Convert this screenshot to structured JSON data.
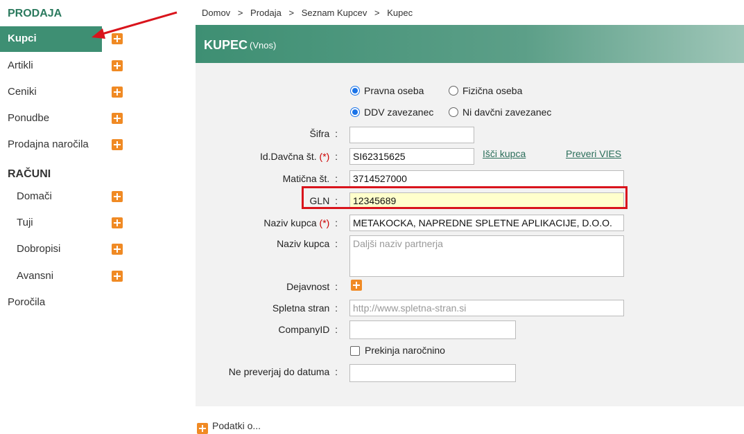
{
  "sidebar": {
    "sales_title": "PRODAJA",
    "sales_items": [
      {
        "label": "Kupci"
      },
      {
        "label": "Artikli"
      },
      {
        "label": "Ceniki"
      },
      {
        "label": "Ponudbe"
      },
      {
        "label": "Prodajna naročila"
      }
    ],
    "invoices_title": "RAČUNI",
    "invoice_items": [
      {
        "label": "Domači"
      },
      {
        "label": "Tuji"
      },
      {
        "label": "Dobropisi"
      },
      {
        "label": "Avansni"
      }
    ],
    "reports_label": "Poročila"
  },
  "breadcrumb": [
    "Domov",
    ">",
    "Prodaja",
    ">",
    "Seznam Kupcev",
    ">",
    "Kupec"
  ],
  "header": {
    "title": "KUPEC",
    "subtitle": "(Vnos)"
  },
  "form": {
    "radio_legal": "Pravna oseba",
    "radio_natural": "Fizična oseba",
    "radio_vat": "DDV zavezanec",
    "radio_novat": "Ni davčni zavezanec",
    "sifra_label": "Šifra",
    "sifra_value": "",
    "taxid_label": "Id.Davčna št.",
    "required_mark": "(*)",
    "taxid_value": "SI62315625",
    "search_link": "Išči kupca",
    "vies_link": "Preveri VIES",
    "reg_label": "Matična št.",
    "reg_value": "3714527000",
    "gln_label": "GLN",
    "gln_value": "12345689",
    "name_label": "Naziv kupca",
    "name_value": "METAKOCKA, NAPREDNE SPLETNE APLIKACIJE, D.O.O.",
    "name2_label": "Naziv kupca",
    "name2_placeholder": "Daljši naziv partnerja",
    "activity_label": "Dejavnost",
    "web_label": "Spletna stran",
    "web_placeholder": "http://www.spletna-stran.si",
    "company_label": "CompanyID",
    "company_value": "",
    "discontinue_label": "Prekinja naročnino",
    "nocheck_label": "Ne preverjaj do datuma",
    "nocheck_value": "",
    "colon": ":"
  },
  "footer_cut": "Podatki o...",
  "colors": {
    "accent": "#3e8f73",
    "plus": "#f08a24",
    "highlight": "#ffffcc",
    "annotation": "#d9141c"
  }
}
